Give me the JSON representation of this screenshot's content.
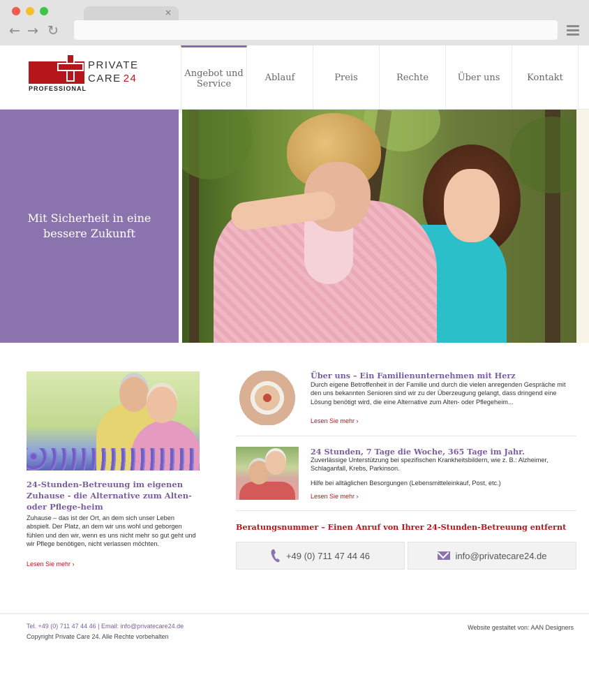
{
  "site": {
    "logo": {
      "line1": "PRIVATE",
      "line2": "CARE",
      "number": "24",
      "subline": "PROFESSIONAL"
    },
    "nav": [
      {
        "label": "Angebot und Service"
      },
      {
        "label": "Ablauf"
      },
      {
        "label": "Preis"
      },
      {
        "label": "Rechte"
      },
      {
        "label": "Über uns"
      },
      {
        "label": "Kontakt"
      }
    ],
    "active_nav_color": "#8b6aa8"
  },
  "hero": {
    "tagline": "Mit Sicherheit in eine bessere Zukunft",
    "panel_color": "#8b74ad"
  },
  "feature": {
    "title": "24-Stunden-Betreuung im eigenen Zuhause - die Alternative zum Alten- oder Pflege-heim",
    "body": "Zuhause – das ist der Ort, an dem sich unser Leben abspielt. Der Platz, an dem wir uns wohl und geborgen fühlen und den wir, wenn es uns nicht mehr so gut geht und wir Pflege benötigen, nicht verlassen möchten.",
    "more": "Lesen Sie mehr ›"
  },
  "articles": [
    {
      "title": "Über uns – Ein Familienunternehmen mit Herz",
      "body": "Durch eigene Betroffenheit in der Familie und durch die vielen anregenden Gespräche mit den uns bekannten Senioren sind wir zu der Überzeugung gelangt, dass dringend eine Lösung benötigt wird, die eine Alternative zum Alten- oder Pflegeheim...",
      "more": "Lesen Sie mehr ›"
    },
    {
      "title": "24 Stunden, 7 Tage die Woche, 365 Tage im Jahr.",
      "body": "Zuverlässige Unterstützung bei spezifischen Krankheitsbildern, wie z. B.: Alzheimer, Schlaganfall, Krebs, Parkinson.",
      "body2": "Hilfe bei alltäglichen Besorgungen (Lebensmitteleinkauf, Post, etc.)",
      "more": "Lesen Sie mehr ›"
    }
  ],
  "cta": {
    "title": "Beratungsnummer – Einen Anruf von Ihrer 24-Stunden-Betreuung entfernt",
    "phone": "+49 (0) 711 47 44 46",
    "email": "info@privatecare24.de",
    "accent_color": "#b5161b"
  },
  "footer": {
    "contact": "Tel. +49 (0) 711 47 44 46  | Email: info@privatecare24.de",
    "copyright": "Copyright Private Care 24. Alle Rechte vorbehalten",
    "credit": "Website gestaltet von: AAN Designers"
  },
  "browser": {
    "tab_close": "×",
    "back": "←",
    "forward": "→",
    "reload": "↻"
  }
}
